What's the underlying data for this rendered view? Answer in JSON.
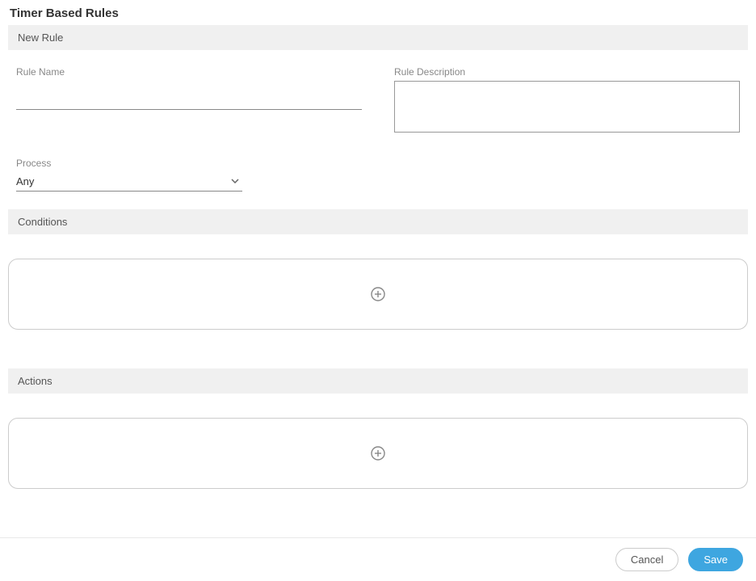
{
  "page": {
    "title": "Timer Based Rules"
  },
  "sections": {
    "new_rule": "New Rule",
    "conditions": "Conditions",
    "actions": "Actions"
  },
  "fields": {
    "rule_name": {
      "label": "Rule Name",
      "value": ""
    },
    "rule_description": {
      "label": "Rule Description",
      "value": ""
    },
    "process": {
      "label": "Process",
      "value": "Any"
    }
  },
  "buttons": {
    "cancel": "Cancel",
    "save": "Save"
  }
}
